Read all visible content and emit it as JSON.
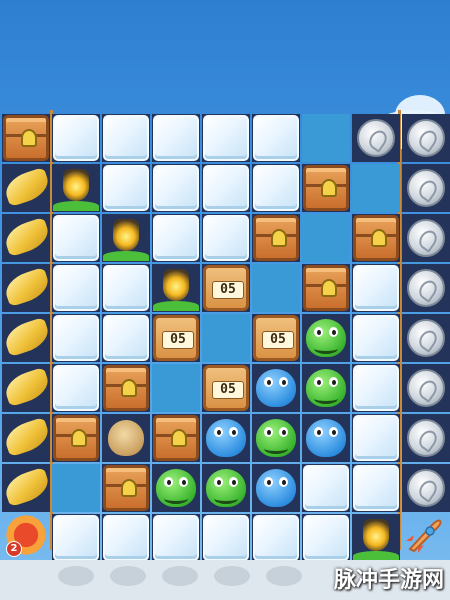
{
  "game": {
    "columns": 9,
    "rows": 9,
    "column_types": {
      "0": "banana-column",
      "8": "coin-column"
    },
    "grid": [
      [
        "chest",
        "ice",
        "ice",
        "ice",
        "ice",
        "ice",
        "water",
        "coin",
        "coin"
      ],
      [
        "banana",
        "lantern",
        "ice",
        "ice",
        "ice",
        "ice",
        "chest",
        "water",
        "coin"
      ],
      [
        "banana",
        "ice",
        "lantern",
        "ice",
        "ice",
        "chest",
        "water",
        "chest",
        "coin"
      ],
      [
        "banana",
        "ice",
        "ice",
        "lantern",
        "counter",
        "water",
        "chest",
        "ice",
        "coin"
      ],
      [
        "banana",
        "ice",
        "ice",
        "counter",
        "water",
        "counter",
        "green",
        "ice",
        "coin"
      ],
      [
        "banana",
        "ice",
        "chest",
        "water",
        "counter",
        "blue",
        "green",
        "ice",
        "coin"
      ],
      [
        "banana",
        "chest",
        "nut",
        "chest",
        "blue",
        "green",
        "blue",
        "ice",
        "coin"
      ],
      [
        "banana",
        "water",
        "chest",
        "green",
        "green",
        "blue",
        "ice",
        "ice",
        "coin"
      ],
      [
        "sunflower",
        "ice",
        "ice",
        "ice",
        "ice",
        "ice",
        "ice",
        "lantern",
        "rocket"
      ]
    ],
    "counters": [
      {
        "row": 3,
        "col": 4,
        "value": "05"
      },
      {
        "row": 4,
        "col": 3,
        "value": "05"
      },
      {
        "row": 4,
        "col": 5,
        "value": "05"
      },
      {
        "row": 5,
        "col": 4,
        "value": "05"
      }
    ],
    "sunflower_badge": "2",
    "icons": {
      "banana": "banana-icon",
      "coin": "silver-coin-icon",
      "chest": "treasure-chest-icon",
      "lantern": "glowing-jar-icon",
      "blue": "blue-hippo-icon",
      "green": "green-frog-icon",
      "nut": "nut-icon",
      "sunflower": "sunflower-icon",
      "rocket": "rocket-icon"
    }
  },
  "watermark": "脉冲手游网",
  "colors": {
    "sky": "#3f93e0",
    "board": "#23335a",
    "ice": "#e9f5ff",
    "chest": "#c96f2d"
  }
}
